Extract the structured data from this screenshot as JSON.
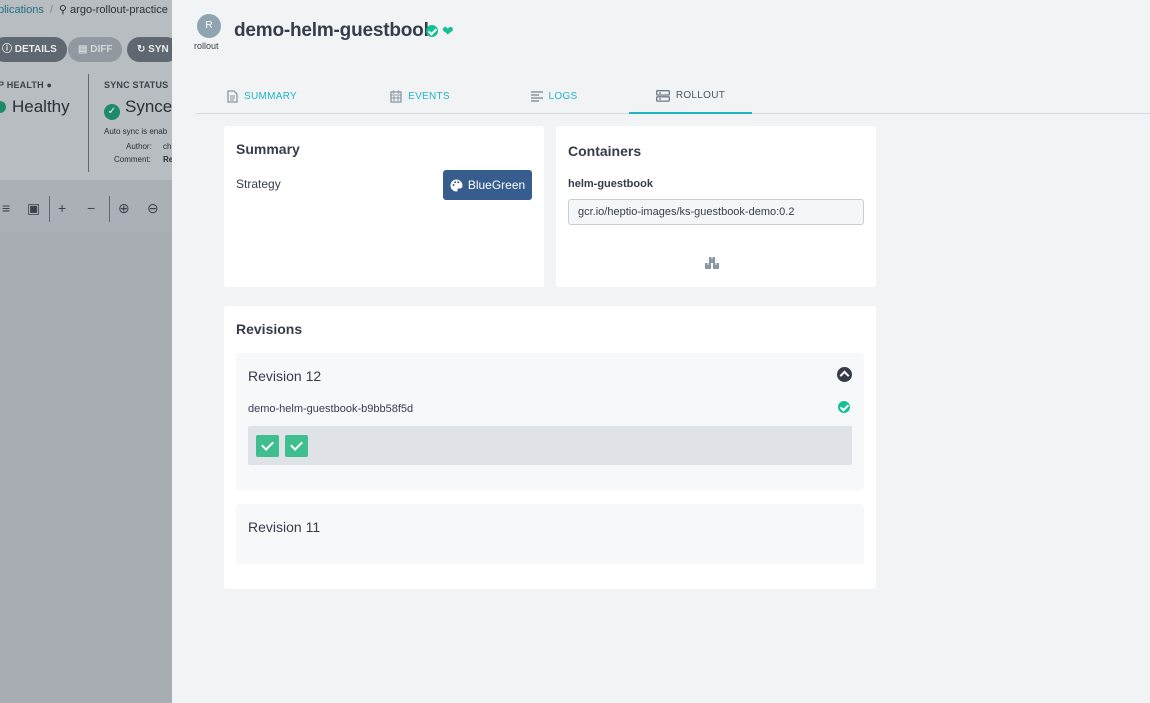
{
  "background_app": {
    "breadcrumb": {
      "applications": "plications",
      "search_text": "argo-rollout-practice"
    },
    "buttons": {
      "details": "DETAILS",
      "diff": "DIFF",
      "sync": "SYN"
    },
    "app_health_label": "P HEALTH",
    "app_health_value": "Healthy",
    "sync_status_label": "SYNC STATUS",
    "sync_status_value": "Synce",
    "auto_sync_text": "Auto sync is enab",
    "author_label": "Author:",
    "author_value": "ch",
    "comment_label": "Comment:",
    "comment_value": "Re"
  },
  "panel": {
    "kind_icon_letter": "R",
    "kind_label": "rollout",
    "title": "demo-helm-guestbook",
    "tabs": [
      {
        "label": "SUMMARY",
        "icon": "file-icon"
      },
      {
        "label": "EVENTS",
        "icon": "calendar-icon"
      },
      {
        "label": "LOGS",
        "icon": "align-left-icon"
      },
      {
        "label": "ROLLOUT",
        "icon": "server-icon",
        "active": true
      }
    ],
    "summary": {
      "title": "Summary",
      "strategy_label": "Strategy",
      "strategy_value": "BlueGreen"
    },
    "containers": {
      "title": "Containers",
      "container_name": "helm-guestbook",
      "image": "gcr.io/heptio-images/ks-guestbook-demo:0.2"
    },
    "revisions": {
      "title": "Revisions",
      "items": [
        {
          "label": "Revision 12",
          "replicaset": "demo-helm-guestbook-b9bb58f5d",
          "pods": 2,
          "expanded": true
        },
        {
          "label": "Revision 11",
          "expanded": false
        }
      ]
    },
    "colors": {
      "accent": "#1fb5c5",
      "healthy": "#18be94",
      "strategy_button": "#365d8d",
      "pod_ok": "#3fbf8d"
    }
  }
}
